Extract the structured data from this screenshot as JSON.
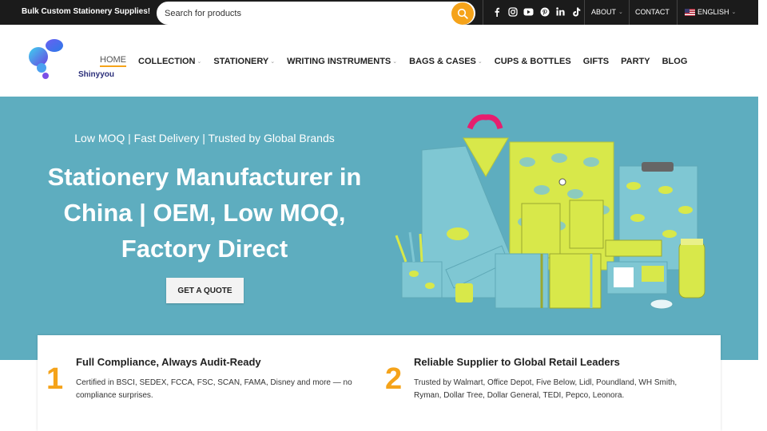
{
  "topbar": {
    "promo": "Bulk Custom Stationery Supplies!",
    "search_placeholder": "Search for products",
    "socials": [
      "facebook-icon",
      "instagram-icon",
      "youtube-icon",
      "pinterest-icon",
      "linkedin-icon",
      "tiktok-icon"
    ],
    "about": "ABOUT",
    "contact": "CONTACT",
    "language": "ENGLISH"
  },
  "header": {
    "logo_text": "Shinyyou",
    "nav": [
      {
        "label": "HOME",
        "dropdown": false
      },
      {
        "label": "COLLECTION",
        "dropdown": true
      },
      {
        "label": "STATIONERY",
        "dropdown": true
      },
      {
        "label": "WRITING INSTRUMENTS",
        "dropdown": true
      },
      {
        "label": "BAGS & CASES",
        "dropdown": true
      },
      {
        "label": "CUPS & BOTTLES",
        "dropdown": false
      },
      {
        "label": "GIFTS",
        "dropdown": false
      },
      {
        "label": "PARTY",
        "dropdown": false
      },
      {
        "label": "BLOG",
        "dropdown": false
      }
    ]
  },
  "hero": {
    "tagline": "Low MOQ | Fast Delivery | Trusted by Global Brands",
    "title_lines": [
      "Stationery Manufacturer in",
      "China | OEM, Low MOQ,",
      "Factory Direct"
    ],
    "cta": "GET A QUOTE"
  },
  "features": [
    {
      "number": "1",
      "title": "Full Compliance, Always Audit-Ready",
      "desc_lines": [
        "Certified in BSCI, SEDEX, FCCA, FSC, SCAN, FAMA, Disney and more — no",
        "compliance surprises."
      ]
    },
    {
      "number": "2",
      "title": "Reliable Supplier to Global Retail Leaders",
      "desc_lines": [
        "Trusted by Walmart, Office Depot, Five Below, Lidl, Poundland, WH Smith,",
        "Ryman, Dollar Tree, Dollar General, TEDI, Pepco, Leonora."
      ]
    }
  ],
  "colors": {
    "accent": "#f5a31a",
    "hero_bg": "#5eadbf",
    "topbar_bg": "#1b1b1b",
    "product_lime": "#d8e84a",
    "product_teal": "#7fc7d3"
  }
}
